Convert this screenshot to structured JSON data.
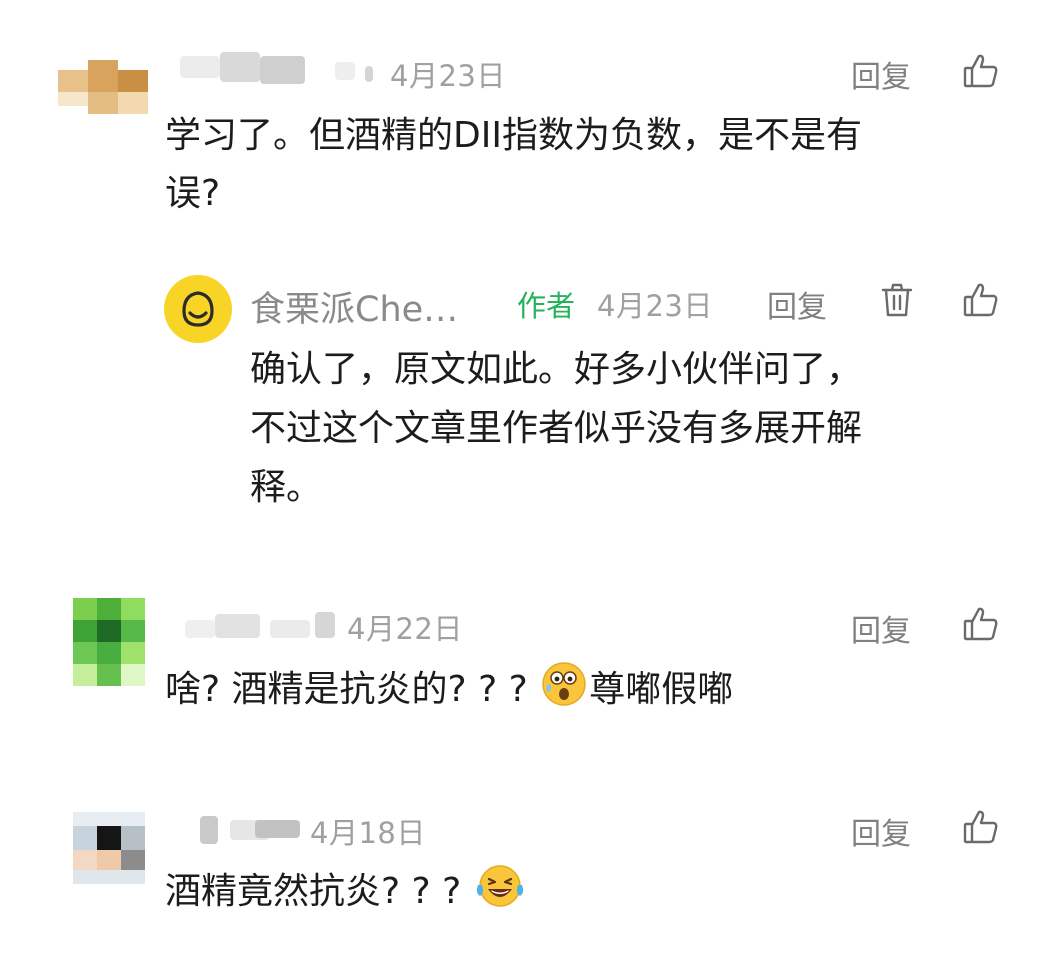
{
  "comments": [
    {
      "date": "4月23日",
      "reply_label": "回复",
      "text_lines": [
        "学习了。但酒精的DII指数为负数，是不是有",
        "误?"
      ]
    },
    {
      "date": "4月22日",
      "reply_label": "回复",
      "text_before_emoji": "啥? 酒精是抗炎的? ? ?",
      "text_after_emoji": "尊嘟假嘟"
    },
    {
      "date": "4月18日",
      "reply_label": "回复",
      "text_before_emoji": "酒精竟然抗炎? ? ?"
    }
  ],
  "reply": {
    "author_name": "食栗派Che…",
    "author_tag": "作者",
    "date": "4月23日",
    "reply_label": "回复",
    "text_lines": [
      "确认了，原文如此。好多小伙伴问了，",
      "不过这个文章里作者似乎没有多展开解",
      "释。"
    ]
  },
  "colors": {
    "text": "#1c1c1c",
    "meta": "#a0a0a0",
    "author_tag": "#26b15b",
    "avatar_yellow": "#f7d426"
  },
  "icons": [
    "thumbs-up-icon",
    "trash-icon",
    "smiley-avatar-icon",
    "surprised-emoji-icon",
    "laughing-tears-emoji-icon"
  ]
}
